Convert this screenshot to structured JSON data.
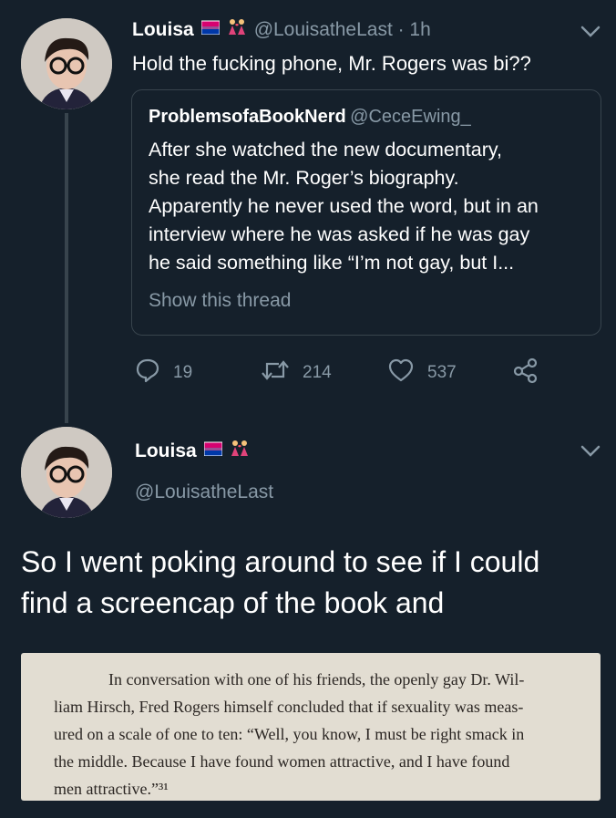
{
  "tweet1": {
    "name": "Louisa",
    "handle_time": "@LouisatheLast · 1h",
    "text": "Hold the fucking phone, Mr. Rogers was bi??",
    "flag_icon": "bi-flag-icon",
    "couple_icon": "couple-icon",
    "quote": {
      "name": "ProblemsofaBookNerd",
      "handle": "@CeceEwing_",
      "lines": [
        "After she watched the new documentary,",
        "she read the Mr. Roger’s biography.",
        "Apparently he never used the word, but in an",
        "interview where he was asked if he was gay",
        "he said something like “I’m not gay, but I..."
      ],
      "show_thread": "Show this thread"
    },
    "actions": {
      "replies": "19",
      "retweets": "214",
      "likes": "537"
    }
  },
  "tweet2": {
    "name": "Louisa",
    "handle": "@LouisatheLast",
    "text_lines": [
      "So I went poking around to see if I could",
      "find a screencap of the book and"
    ],
    "book_lines": [
      "In conversation with one of his friends, the openly gay Dr. Wil-",
      "liam Hirsch, Fred Rogers himself concluded that if sexuality was meas-",
      "ured on a scale of one to ten: “Well, you know, I must be right smack in",
      "the middle. Because I have found women attractive, and I have found",
      "men attractive.”³¹"
    ]
  },
  "colors": {
    "background": "#15202b",
    "secondary_text": "#8899a6",
    "border": "#38444d",
    "page_paper": "#e2ddd2"
  }
}
